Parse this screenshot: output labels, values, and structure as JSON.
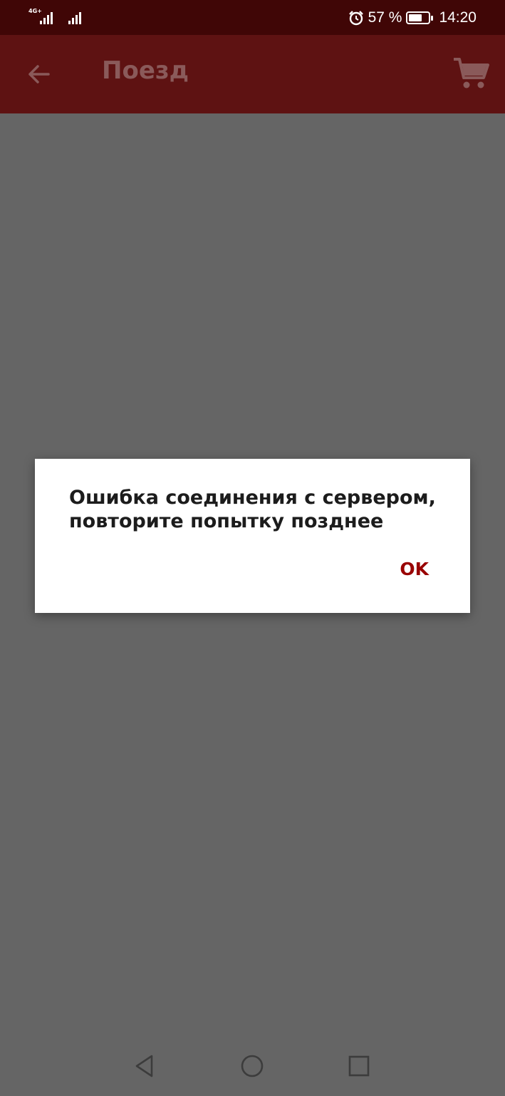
{
  "status_bar": {
    "network_type": "4G+",
    "battery_percent": "57 %",
    "battery_level": 0.57,
    "time": "14:20",
    "icons": [
      "signal-icon",
      "alarm-icon",
      "battery-icon"
    ]
  },
  "toolbar": {
    "title": "Поезд",
    "icons": [
      "back-arrow-icon",
      "cart-icon"
    ]
  },
  "dialog": {
    "message": "Ошибка соединения с сервером, повторите попытку позднее",
    "ok_label": "OK"
  },
  "navigation": {
    "icons": [
      "back-triangle-icon",
      "home-circle-icon",
      "recents-square-icon"
    ]
  },
  "colors": {
    "status_bar": "#400606",
    "toolbar": "#5e1212",
    "scrim": "#656565",
    "accent": "#990000"
  }
}
